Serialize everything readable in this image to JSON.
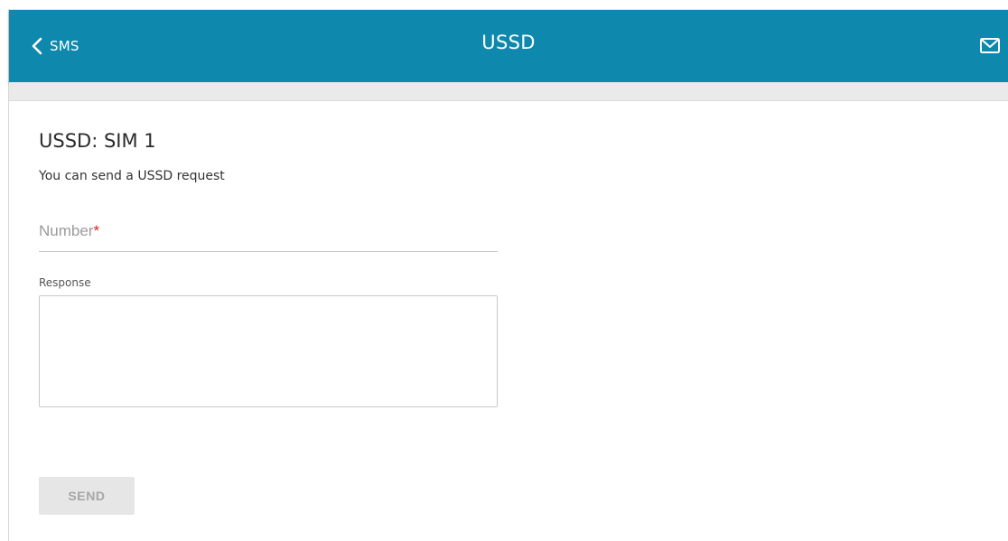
{
  "header": {
    "back_label": "SMS",
    "title": "USSD",
    "back_icon": "chevron-left-icon",
    "mail_icon": "envelope-icon",
    "bg_color": "#0f88ad"
  },
  "section": {
    "title": "USSD: SIM 1",
    "description": "You can send a USSD request"
  },
  "form": {
    "number": {
      "placeholder": "Number",
      "required_mark": "*",
      "value": ""
    },
    "response": {
      "label": "Response",
      "value": ""
    },
    "send_label": "SEND",
    "send_enabled": false
  }
}
